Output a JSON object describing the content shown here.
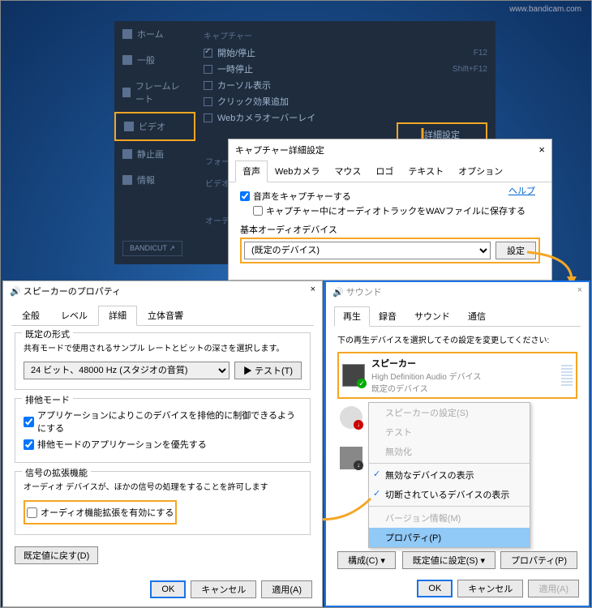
{
  "watermark": "www.bandicam.com",
  "bandicam": {
    "sidebar": {
      "home": "ホーム",
      "general": "一般",
      "framerate": "フレームレート",
      "video": "ビデオ",
      "still": "静止画",
      "info": "情報",
      "bandicut": "BANDICUT ↗"
    },
    "capture_title": "キャプチャー",
    "checks": [
      {
        "label": "開始/停止",
        "checked": true,
        "hotkey": "F12"
      },
      {
        "label": "一時停止",
        "checked": false,
        "hotkey": "Shift+F12"
      },
      {
        "label": "カーソル表示",
        "checked": false,
        "hotkey": ""
      },
      {
        "label": "クリック効果追加",
        "checked": false,
        "hotkey": ""
      },
      {
        "label": "Webカメラオーバーレイ",
        "checked": false,
        "hotkey": ""
      }
    ],
    "detail_btn": "詳細設定",
    "labels": {
      "format": "フォー",
      "vid": "ビデオ",
      "audio": "オーデ"
    }
  },
  "capture_dialog": {
    "title": "キャプチャー詳細設定",
    "tabs": [
      "音声",
      "Webカメラ",
      "マウス",
      "ロゴ",
      "テキスト",
      "オプション"
    ],
    "active_tab": 0,
    "capture_audio": "音声をキャプチャーする",
    "save_wav": "キャプチャー中にオーディオトラックをWAVファイルに保存する",
    "help": "ヘルプ",
    "device_label": "基本オーディオデバイス",
    "device_value": "(既定のデバイス)",
    "settings_btn": "設定"
  },
  "sound_dialog": {
    "title": "サウンド",
    "tabs": [
      "再生",
      "録音",
      "サウンド",
      "通信"
    ],
    "active_tab": 0,
    "desc": "下の再生デバイスを選択してその設定を変更してください:",
    "device": {
      "name": "スピーカー",
      "driver": "High Definition Audio デバイス",
      "status": "既定のデバイス"
    },
    "menu": {
      "set_speaker": "スピーカーの設定(S)",
      "test": "テスト",
      "disable": "無効化",
      "show_disabled": "無効なデバイスの表示",
      "show_disconnected": "切断されているデバイスの表示",
      "version": "バージョン情報(M)",
      "properties": "プロパティ(P)"
    },
    "configure_btn": "構成(C)",
    "set_default_btn": "既定値に設定(S)",
    "properties_btn": "プロパティ(P)",
    "ok": "OK",
    "cancel": "キャンセル",
    "apply": "適用(A)"
  },
  "speaker_dialog": {
    "title": "スピーカーのプロパティ",
    "tabs": [
      "全般",
      "レベル",
      "詳細",
      "立体音響"
    ],
    "active_tab": 2,
    "default_format": {
      "title": "既定の形式",
      "desc": "共有モードで使用されるサンプル レートとビットの深さを選択します。",
      "value": "24 ビット、48000 Hz (スタジオの音質)",
      "test_btn": "▶ テスト(T)"
    },
    "exclusive": {
      "title": "排他モード",
      "allow": "アプリケーションによりこのデバイスを排他的に制御できるようにする",
      "priority": "排他モードのアプリケーションを優先する"
    },
    "enhance": {
      "title": "信号の拡張機能",
      "desc": "オーディオ デバイスが、ほかの信号の処理をすることを許可します",
      "enable": "オーディオ機能拡張を有効にする"
    },
    "reset_btn": "既定値に戻す(D)",
    "ok": "OK",
    "cancel": "キャンセル",
    "apply": "適用(A)"
  }
}
